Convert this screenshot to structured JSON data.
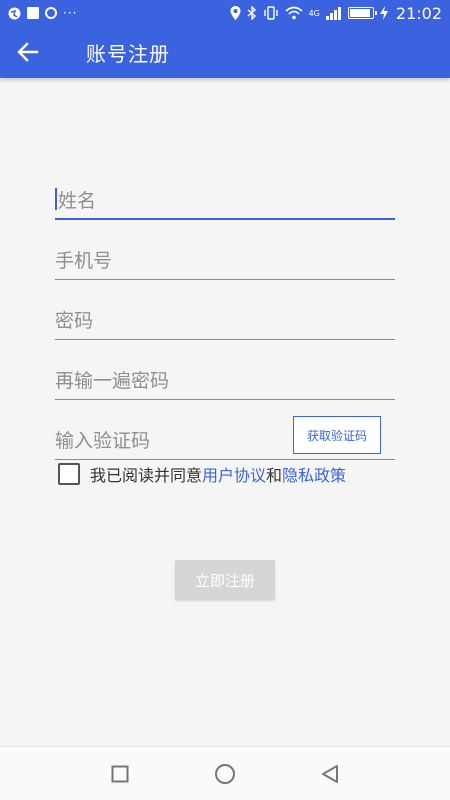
{
  "statusbar": {
    "time": "21:02",
    "dots": "···",
    "network": "4G"
  },
  "appbar": {
    "title": "账号注册",
    "back_icon": "arrow-left-icon"
  },
  "form": {
    "name_placeholder": "姓名",
    "phone_placeholder": "手机号",
    "password_placeholder": "密码",
    "confirm_placeholder": "再输一遍密码",
    "code_placeholder": "输入验证码",
    "code_button": "获取验证码"
  },
  "agreement": {
    "prefix": "我已阅读并同意",
    "user_agreement": "用户协议",
    "and": "和",
    "privacy_policy": "隐私政策",
    "checked": false
  },
  "submit": {
    "label": "立即注册"
  },
  "colors": {
    "primary": "#3b63e0",
    "disabled": "#d6d6d6",
    "text": "#333333",
    "placeholder": "#8f8f8f"
  }
}
